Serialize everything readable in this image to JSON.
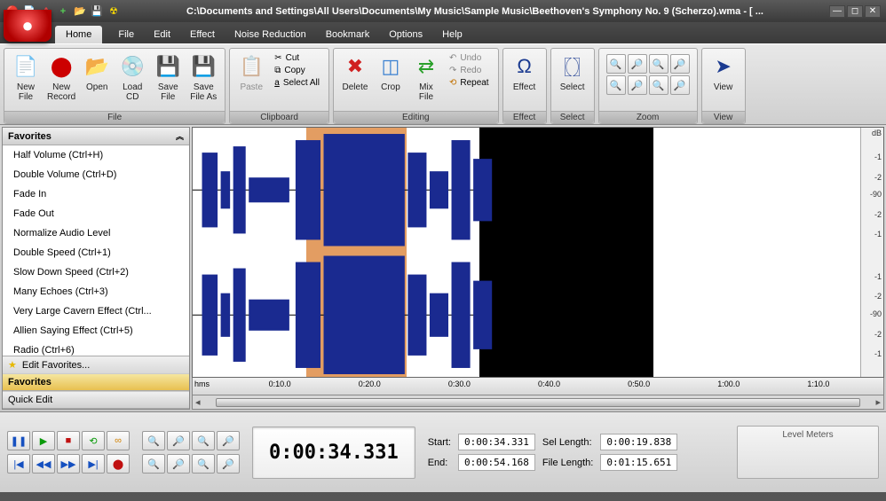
{
  "title": "C:\\Documents and Settings\\All Users\\Documents\\My Music\\Sample Music\\Beethoven's Symphony No. 9 (Scherzo).wma - [ ...",
  "tabs": {
    "home": "Home"
  },
  "menus": [
    "File",
    "Edit",
    "Effect",
    "Noise Reduction",
    "Bookmark",
    "Options",
    "Help"
  ],
  "ribbon": {
    "file": {
      "label": "File",
      "new_file": "New\nFile",
      "new_record": "New\nRecord",
      "open": "Open",
      "load_cd": "Load\nCD",
      "save_file": "Save\nFile",
      "save_as": "Save\nFile As"
    },
    "clipboard": {
      "label": "Clipboard",
      "paste": "Paste",
      "cut": "Cut",
      "copy": "Copy",
      "select_all": "Select All"
    },
    "editing": {
      "label": "Editing",
      "delete": "Delete",
      "crop": "Crop",
      "mix_file": "Mix\nFile",
      "undo": "Undo",
      "redo": "Redo",
      "repeat": "Repeat"
    },
    "effect": {
      "label": "Effect",
      "btn": "Effect"
    },
    "select": {
      "label": "Select",
      "btn": "Select"
    },
    "zoom": {
      "label": "Zoom"
    },
    "view": {
      "label": "View",
      "btn": "View"
    }
  },
  "sidebar": {
    "header": "Favorites",
    "items": [
      "Half Volume (Ctrl+H)",
      "Double Volume (Ctrl+D)",
      "Fade In",
      "Fade Out",
      "Normalize Audio Level",
      "Double Speed (Ctrl+1)",
      "Slow Down Speed (Ctrl+2)",
      "Many Echoes (Ctrl+3)",
      "Very Large Cavern Effect (Ctrl...",
      "Allien Saying Effect (Ctrl+5)",
      "Radio (Ctrl+6)"
    ],
    "edit": "Edit Favorites...",
    "btn1": "Favorites",
    "btn2": "Quick Edit"
  },
  "db_scale": {
    "unit": "dB",
    "ticks": [
      "-1",
      "-2",
      "-90",
      "-2",
      "-1"
    ]
  },
  "timeline": {
    "unit": "hms",
    "ticks": [
      "0:10.0",
      "0:20.0",
      "0:30.0",
      "0:40.0",
      "0:50.0",
      "1:00.0",
      "1:10.0"
    ]
  },
  "timecode": "0:00:34.331",
  "info": {
    "start_lbl": "Start:",
    "start": "0:00:34.331",
    "end_lbl": "End:",
    "end": "0:00:54.168",
    "sel_lbl": "Sel Length:",
    "sel": "0:00:19.838",
    "file_lbl": "File Length:",
    "file": "0:01:15.651"
  },
  "meters_label": "Level Meters"
}
